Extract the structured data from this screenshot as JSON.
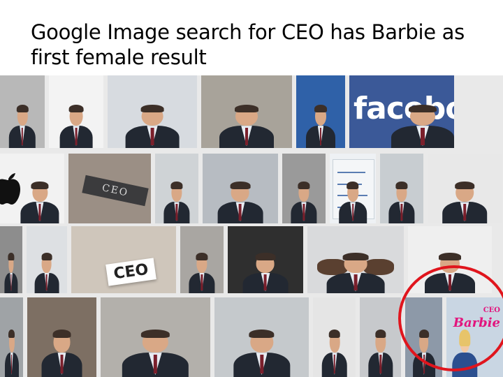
{
  "slide": {
    "title": "Google Image search for CEO has Barbie as first female result"
  },
  "grid": {
    "rows": [
      {
        "tiles": [
          {
            "name": "photo-1-1",
            "w": 64,
            "bg": "#b8b8b8",
            "kind": "person"
          },
          {
            "name": "photo-1-2",
            "w": 78,
            "bg": "#f3f3f3",
            "kind": "person"
          },
          {
            "name": "photo-1-3",
            "w": 128,
            "bg": "#d7dbe0",
            "kind": "person"
          },
          {
            "name": "photo-1-4",
            "w": 130,
            "bg": "#a8a39a",
            "kind": "person"
          },
          {
            "name": "photo-1-5",
            "w": 70,
            "bg": "#2f61a8",
            "kind": "person"
          },
          {
            "name": "photo-1-6",
            "w": 150,
            "bg": "#3b5998",
            "kind": "facebook"
          }
        ]
      },
      {
        "tiles": [
          {
            "name": "photo-2-1",
            "w": 92,
            "bg": "#f2f2f2",
            "kind": "apple"
          },
          {
            "name": "photo-2-2",
            "w": 118,
            "bg": "#9b8f85",
            "kind": "plaque"
          },
          {
            "name": "photo-2-3",
            "w": 62,
            "bg": "#cfd3d6",
            "kind": "person"
          },
          {
            "name": "photo-2-4",
            "w": 108,
            "bg": "#b7bcc2",
            "kind": "person"
          },
          {
            "name": "photo-2-5",
            "w": 62,
            "bg": "#9a9a9a",
            "kind": "person"
          },
          {
            "name": "photo-2-6",
            "w": 66,
            "bg": "#eef1f4",
            "kind": "whiteboard"
          },
          {
            "name": "photo-2-7",
            "w": 62,
            "bg": "#c8cdd1",
            "kind": "person"
          },
          {
            "name": "photo-2-8",
            "w": 106,
            "bg": "#e8e8e8",
            "kind": "person"
          }
        ]
      },
      {
        "tiles": [
          {
            "name": "photo-3-1",
            "w": 32,
            "bg": "#8d8d8d",
            "kind": "person"
          },
          {
            "name": "photo-3-2",
            "w": 58,
            "bg": "#dde0e3",
            "kind": "person"
          },
          {
            "name": "photo-3-3",
            "w": 150,
            "bg": "#cfc6bb",
            "kind": "ceo-card"
          },
          {
            "name": "photo-3-4",
            "w": 62,
            "bg": "#a9a6a2",
            "kind": "person"
          },
          {
            "name": "photo-3-5",
            "w": 108,
            "bg": "#2f2f2f",
            "kind": "person"
          },
          {
            "name": "photo-3-6",
            "w": 138,
            "bg": "#d9dadc",
            "kind": "feet"
          },
          {
            "name": "photo-3-7",
            "w": 120,
            "bg": "#efefef",
            "kind": "person"
          }
        ]
      },
      {
        "tiles": [
          {
            "name": "photo-4-1",
            "w": 34,
            "bg": "#9fa3a6",
            "kind": "person"
          },
          {
            "name": "photo-4-2",
            "w": 100,
            "bg": "#7d6f63",
            "kind": "person"
          },
          {
            "name": "photo-4-3",
            "w": 160,
            "bg": "#b3b0ab",
            "kind": "person"
          },
          {
            "name": "photo-4-4",
            "w": 138,
            "bg": "#c5c9cc",
            "kind": "person"
          },
          {
            "name": "photo-4-5",
            "w": 62,
            "bg": "#e5e5e5",
            "kind": "person"
          },
          {
            "name": "photo-4-6",
            "w": 60,
            "bg": "#c7c9cc",
            "kind": "person"
          },
          {
            "name": "photo-4-7",
            "w": 54,
            "bg": "#8d99a8",
            "kind": "person"
          },
          {
            "name": "photo-4-8",
            "w": 82,
            "bg": "#c9d6e3",
            "kind": "barbie"
          }
        ]
      }
    ],
    "plaque_text": "CEO",
    "card_text": "CEO",
    "barbie_text": "Barbie",
    "barbie_small": "CEO",
    "facebook_text": "facebook",
    "apple_glyph": "",
    "highlight_color": "#e0151d"
  }
}
